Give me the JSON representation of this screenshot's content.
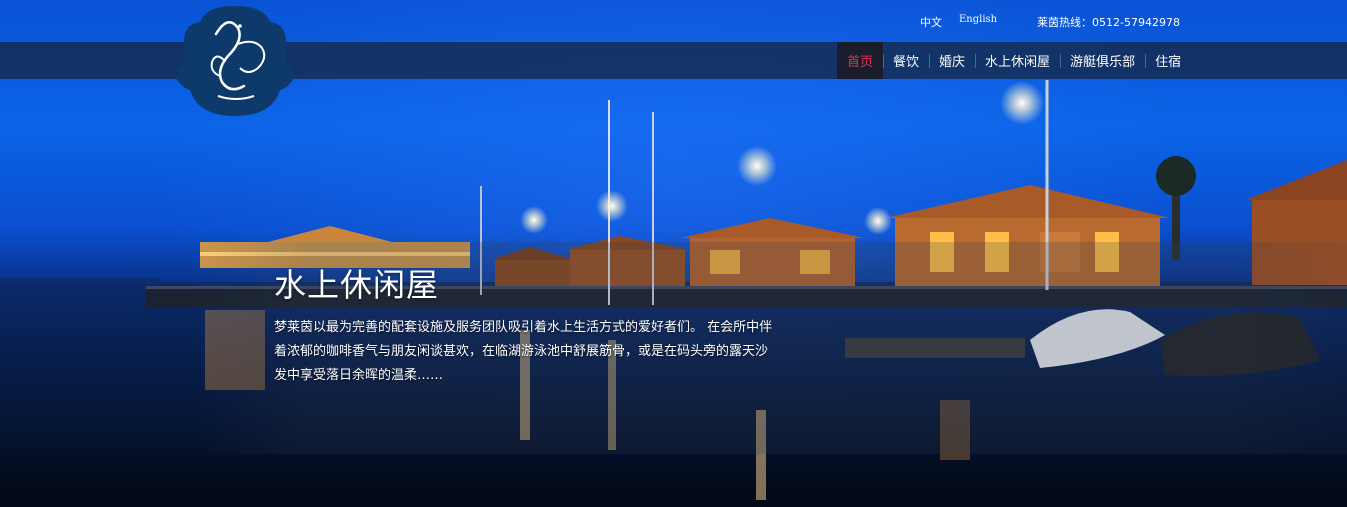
{
  "topbar": {
    "lang_zh": "中文",
    "lang_en": "English",
    "hotline": "莱茵热线：0512-57942978"
  },
  "nav": {
    "items": [
      {
        "label": "首页",
        "active": true
      },
      {
        "label": "餐饮"
      },
      {
        "label": "婚庆"
      },
      {
        "label": "水上休闲屋"
      },
      {
        "label": "游艇俱乐部"
      },
      {
        "label": "住宿"
      }
    ]
  },
  "hero": {
    "title": "水上休闲屋",
    "description": "梦莱茵以最为完善的配套设施及服务团队吸引着水上生活方式的爱好者们。 在会所中伴着浓郁的咖啡香气与朋友闲谈甚欢，在临湖游泳池中舒展筋骨，或是在码头旁的露天沙发中享受落日余晖的温柔……"
  },
  "colors": {
    "accent": "#e2324a",
    "nav_band": "#142846",
    "logo_bg": "#0d3a6a"
  },
  "logo": {
    "icon": "swan-logo-icon"
  }
}
